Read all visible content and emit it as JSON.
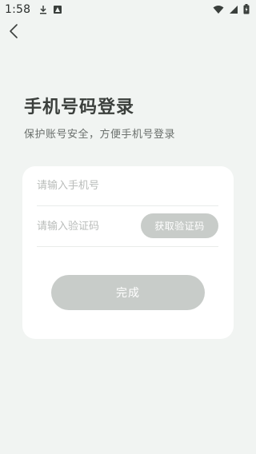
{
  "status_bar": {
    "time": "1:58",
    "icons_left": [
      "download-icon",
      "warning-icon"
    ],
    "icons_right": [
      "wifi-icon",
      "signal-icon",
      "battery-icon"
    ]
  },
  "header": {
    "back_icon": "chevron-left-icon"
  },
  "page": {
    "title": "手机号码登录",
    "subtitle": "保护账号安全，方便手机号登录"
  },
  "form": {
    "phone_placeholder": "请输入手机号",
    "phone_value": "",
    "code_placeholder": "请输入验证码",
    "code_value": "",
    "get_code_label": "获取验证码",
    "submit_label": "完成"
  },
  "colors": {
    "background": "#f1f4f2",
    "card": "#ffffff",
    "button_disabled": "#c8ccc9",
    "title_text": "#3b3f3c",
    "placeholder_text": "#b9bcba"
  }
}
